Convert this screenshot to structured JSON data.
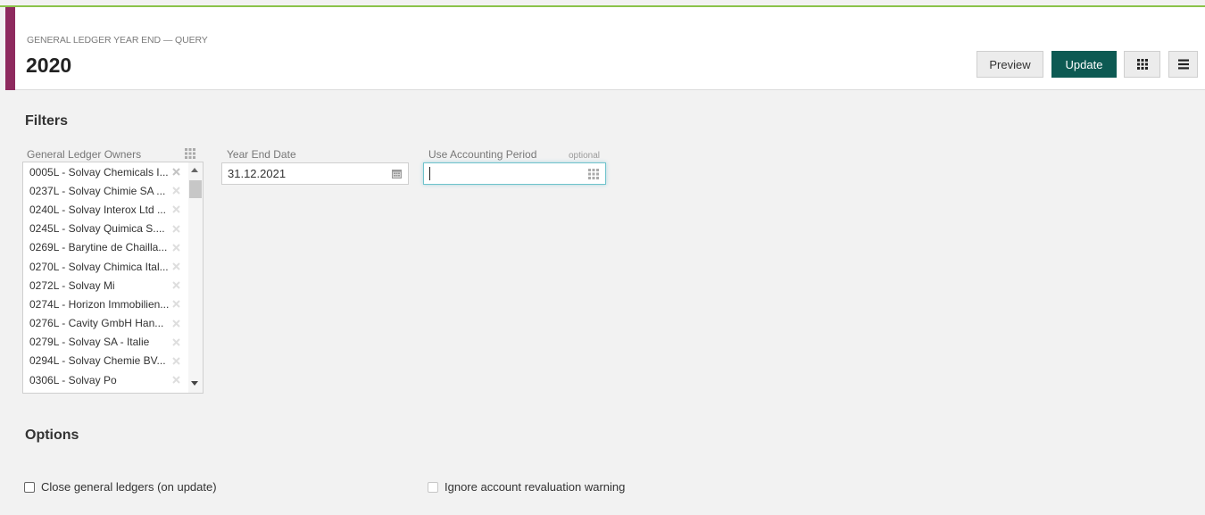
{
  "header": {
    "subtitle": "GENERAL LEDGER YEAR END — QUERY",
    "title": "2020",
    "preview_label": "Preview",
    "update_label": "Update",
    "grid_icon": "grid-icon",
    "menu_icon": "hamburger-menu-icon"
  },
  "filters": {
    "title": "Filters",
    "owners_label": "General Ledger Owners",
    "owners": [
      "0005L - Solvay Chemicals I...",
      "0237L - Solvay Chimie SA ...",
      "0240L - Solvay Interox Ltd ...",
      "0245L - Solvay Quimica S....",
      "0269L - Barytine de Chailla...",
      "0270L - Solvay Chimica Ital...",
      "0272L - Solvay Mi",
      "0274L - Horizon Immobilien...",
      "0276L - Cavity GmbH Han...",
      "0279L - Solvay SA - Italie",
      "0294L - Solvay Chemie BV...",
      "0306L - Solvay Po"
    ],
    "year_end_date_label": "Year End Date",
    "year_end_date_value": "31.12.2021",
    "accounting_period_label": "Use Accounting Period",
    "accounting_period_hint": "optional",
    "accounting_period_value": ""
  },
  "options": {
    "title": "Options",
    "close_ledgers_label": "Close general ledgers (on update)",
    "ignore_revaluation_label": "Ignore account revaluation warning"
  },
  "colors": {
    "accent": "#8e2a5e",
    "primary_button": "#0d5a53",
    "top_line": "#8bc34a",
    "focus": "#6fc3cc"
  }
}
